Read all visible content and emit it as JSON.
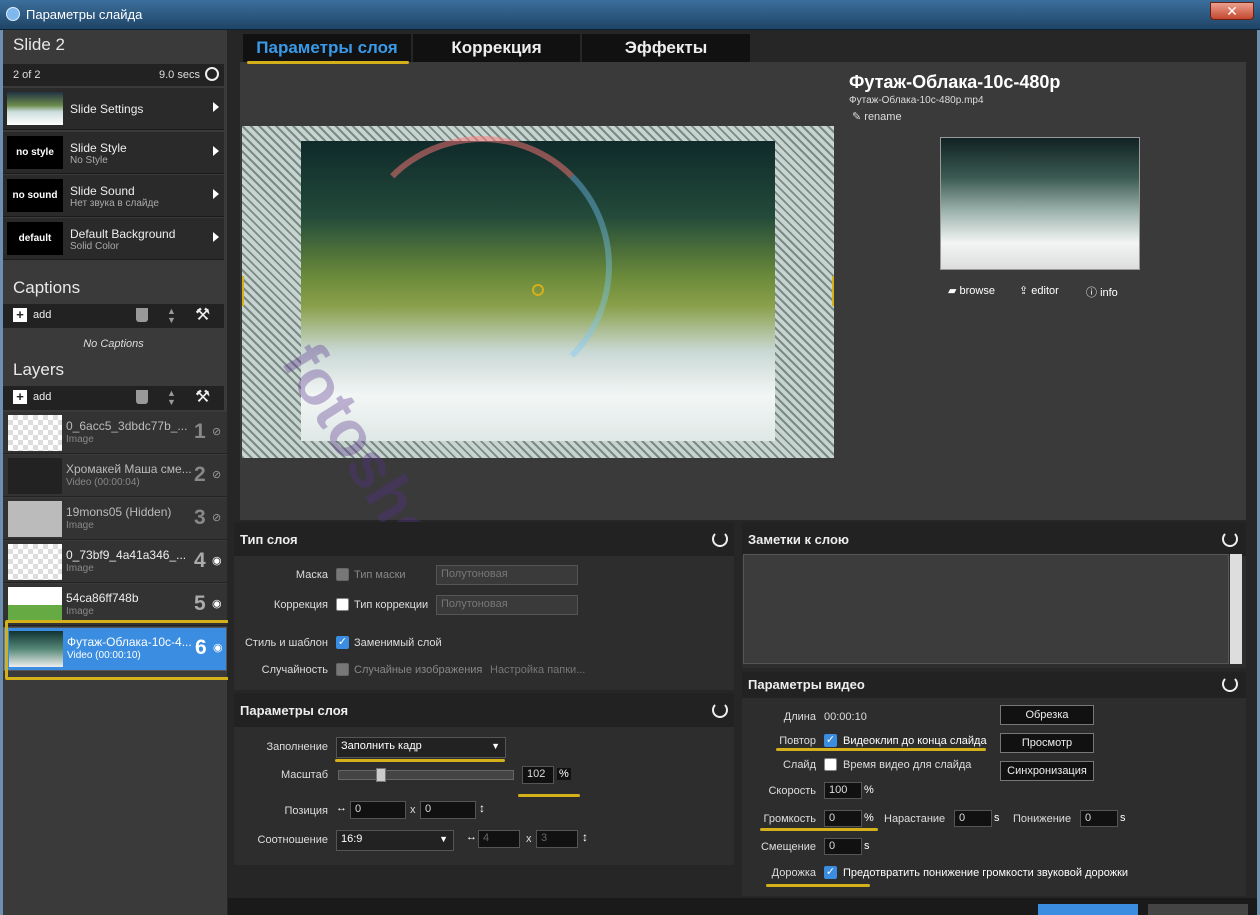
{
  "window": {
    "title": "Параметры слайда",
    "close": "✕"
  },
  "slide": {
    "title": "Slide 2",
    "counter": "2 of 2",
    "duration": "9.0 secs",
    "items": [
      {
        "label": "Slide Settings",
        "sub": "",
        "thumb": ""
      },
      {
        "label": "Slide Style",
        "sub": "No Style",
        "thumb": "no style"
      },
      {
        "label": "Slide Sound",
        "sub": "Нет звука в слайде",
        "thumb": "no sound"
      },
      {
        "label": "Default Background",
        "sub": "Solid Color",
        "thumb": "default"
      }
    ]
  },
  "captions": {
    "title": "Captions",
    "add": "add",
    "empty": "No Captions"
  },
  "layers": {
    "title": "Layers",
    "add": "add",
    "items": [
      {
        "name": "0_6acc5_3dbdc77b_...",
        "type": "Image",
        "num": "1",
        "visible": false
      },
      {
        "name": "Хромакей Маша сме...",
        "type": "Video (00:00:04)",
        "num": "2",
        "visible": false
      },
      {
        "name": "19mons05 (Hidden)",
        "type": "Image",
        "num": "3",
        "visible": false
      },
      {
        "name": "0_73bf9_4a41a346_...",
        "type": "Image",
        "num": "4",
        "visible": true
      },
      {
        "name": "54ca86ff748b",
        "type": "Image",
        "num": "5",
        "visible": true
      },
      {
        "name": "Футаж-Облака-10с-4...",
        "type": "Video (00:00:10)",
        "num": "6",
        "visible": true
      }
    ]
  },
  "tabs": [
    "Параметры слоя",
    "Коррекция",
    "Эффекты"
  ],
  "media": {
    "title": "Футаж-Облака-10с-480р",
    "file": "Футаж-Облака-10с-480р.mp4",
    "rename": "rename",
    "browse": "browse",
    "editor": "editor",
    "info": "info"
  },
  "watermark": "fotoshow.ru",
  "layer_type": {
    "title": "Тип слоя",
    "mask_label": "Маска",
    "mask_check": "Тип маски",
    "mask_select": "Полутоновая",
    "corr_label": "Коррекция",
    "corr_check": "Тип коррекции",
    "corr_select": "Полутоновая",
    "style_label": "Стиль и шаблон",
    "style_check": "Заменимый слой",
    "rand_label": "Случайность",
    "rand_check": "Случайные изображения",
    "rand_link": "Настройка папки..."
  },
  "layer_params": {
    "title": "Параметры слоя",
    "fill_label": "Заполнение",
    "fill_value": "Заполнить кадр",
    "scale_label": "Масштаб",
    "scale_value": "102",
    "pct": "%",
    "pos_label": "Позиция",
    "pos_x": "0",
    "pos_y": "0",
    "x": "x",
    "ratio_label": "Соотношение",
    "ratio_value": "16:9",
    "ratio_w": "4",
    "ratio_h": "3"
  },
  "notes": {
    "title": "Заметки к слою"
  },
  "video": {
    "title": "Параметры видео",
    "len_label": "Длина",
    "len_value": "00:00:10",
    "trim": "Обрезка",
    "repeat_label": "Повтор",
    "repeat_check": "Видеоклип до конца слайда",
    "preview": "Просмотр",
    "slide_label": "Слайд",
    "slide_check": "Время видео для слайда",
    "sync": "Синхронизация",
    "speed_label": "Скорость",
    "speed_value": "100",
    "pct": "%",
    "vol_label": "Громкость",
    "vol_value": "0",
    "fadein_label": "Нарастание",
    "fadein_value": "0",
    "fadeout_label": "Понижение",
    "fadeout_value": "0",
    "s": "s",
    "offset_label": "Смещение",
    "offset_value": "0",
    "track_label": "Дорожка",
    "track_check": "Предотвратить понижение громкости звуковой дорожки"
  }
}
